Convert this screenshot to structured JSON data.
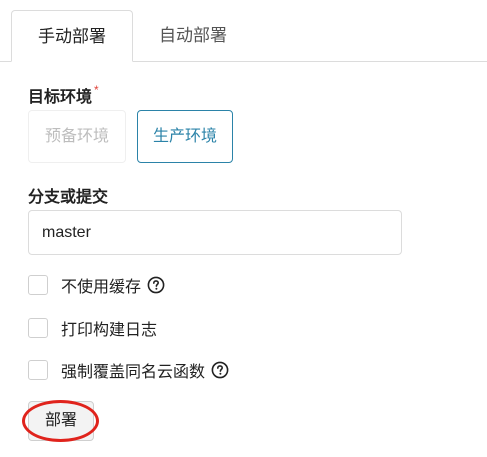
{
  "tabs": [
    {
      "label": "手动部署",
      "active": true
    },
    {
      "label": "自动部署",
      "active": false
    }
  ],
  "environment": {
    "label": "目标环境",
    "required_mark": "*",
    "options": [
      {
        "label": "预备环境",
        "state": "disabled"
      },
      {
        "label": "生产环境",
        "state": "selected"
      }
    ]
  },
  "branch": {
    "label": "分支或提交",
    "value": "master"
  },
  "options": [
    {
      "label": "不使用缓存",
      "checked": false,
      "help_icon": "question-circle-icon"
    },
    {
      "label": "打印构建日志",
      "checked": false
    },
    {
      "label": "强制覆盖同名云函数",
      "checked": false,
      "help_icon": "question-circle-icon"
    }
  ],
  "deploy_button": {
    "label": "部署",
    "annotation_color": "#e0231c"
  },
  "colors": {
    "accent": "#2b83a8",
    "required": "#e0443b",
    "disabled_text": "#bdbdbd"
  }
}
